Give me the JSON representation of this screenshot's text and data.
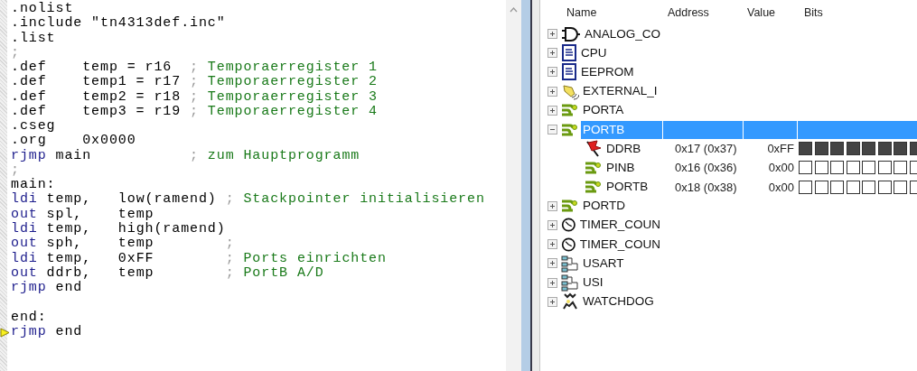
{
  "editor": {
    "lines": [
      {
        "current": false,
        "tokens": [
          {
            "kind": "plain",
            "text": ".nolist"
          }
        ]
      },
      {
        "current": false,
        "tokens": [
          {
            "kind": "plain",
            "text": ".include \"tn4313def.inc\""
          }
        ]
      },
      {
        "current": false,
        "tokens": [
          {
            "kind": "plain",
            "text": ".list"
          }
        ]
      },
      {
        "current": false,
        "tokens": [
          {
            "kind": "separator",
            "text": ";"
          }
        ]
      },
      {
        "current": false,
        "tokens": [
          {
            "kind": "plain",
            "text": ".def    temp = r16  "
          },
          {
            "kind": "separator",
            "text": "; "
          },
          {
            "kind": "comment",
            "text": "Temporaerregister 1"
          }
        ]
      },
      {
        "current": false,
        "tokens": [
          {
            "kind": "plain",
            "text": ".def    temp1 = r17 "
          },
          {
            "kind": "separator",
            "text": "; "
          },
          {
            "kind": "comment",
            "text": "Temporaerregister 2"
          }
        ]
      },
      {
        "current": false,
        "tokens": [
          {
            "kind": "plain",
            "text": ".def    temp2 = r18 "
          },
          {
            "kind": "separator",
            "text": "; "
          },
          {
            "kind": "comment",
            "text": "Temporaerregister 3"
          }
        ]
      },
      {
        "current": false,
        "tokens": [
          {
            "kind": "plain",
            "text": ".def    temp3 = r19 "
          },
          {
            "kind": "separator",
            "text": "; "
          },
          {
            "kind": "comment",
            "text": "Temporaerregister 4"
          }
        ]
      },
      {
        "current": false,
        "tokens": [
          {
            "kind": "plain",
            "text": ".cseg"
          }
        ]
      },
      {
        "current": false,
        "tokens": [
          {
            "kind": "plain",
            "text": ".org    0x0000"
          }
        ]
      },
      {
        "current": false,
        "tokens": [
          {
            "kind": "keyword",
            "text": "rjmp"
          },
          {
            "kind": "plain",
            "text": " main           "
          },
          {
            "kind": "separator",
            "text": "; "
          },
          {
            "kind": "comment",
            "text": "zum Hauptprogramm"
          }
        ]
      },
      {
        "current": false,
        "tokens": [
          {
            "kind": "separator",
            "text": ";"
          }
        ]
      },
      {
        "current": false,
        "tokens": [
          {
            "kind": "plain",
            "text": "main:"
          }
        ]
      },
      {
        "current": false,
        "tokens": [
          {
            "kind": "keyword",
            "text": "ldi"
          },
          {
            "kind": "plain",
            "text": " temp,   low(ramend) "
          },
          {
            "kind": "separator",
            "text": "; "
          },
          {
            "kind": "comment",
            "text": "Stackpointer initialisieren"
          }
        ]
      },
      {
        "current": false,
        "tokens": [
          {
            "kind": "keyword",
            "text": "out"
          },
          {
            "kind": "plain",
            "text": " spl,    temp"
          }
        ]
      },
      {
        "current": false,
        "tokens": [
          {
            "kind": "keyword",
            "text": "ldi"
          },
          {
            "kind": "plain",
            "text": " temp,   high(ramend)"
          }
        ]
      },
      {
        "current": false,
        "tokens": [
          {
            "kind": "keyword",
            "text": "out"
          },
          {
            "kind": "plain",
            "text": " sph,    temp        "
          },
          {
            "kind": "separator",
            "text": ";"
          }
        ]
      },
      {
        "current": false,
        "tokens": [
          {
            "kind": "keyword",
            "text": "ldi"
          },
          {
            "kind": "plain",
            "text": " temp,   0xFF        "
          },
          {
            "kind": "separator",
            "text": "; "
          },
          {
            "kind": "comment",
            "text": "Ports einrichten"
          }
        ]
      },
      {
        "current": false,
        "tokens": [
          {
            "kind": "keyword",
            "text": "out"
          },
          {
            "kind": "plain",
            "text": " ddrb,   temp        "
          },
          {
            "kind": "separator",
            "text": "; "
          },
          {
            "kind": "comment",
            "text": "PortB A/D"
          }
        ]
      },
      {
        "current": false,
        "tokens": [
          {
            "kind": "keyword",
            "text": "rjmp"
          },
          {
            "kind": "plain",
            "text": " end"
          }
        ]
      },
      {
        "current": false
      },
      {
        "current": false,
        "tokens": [
          {
            "kind": "plain",
            "text": "end:"
          }
        ]
      },
      {
        "current": true,
        "tokens": [
          {
            "kind": "keyword",
            "text": "rjmp"
          },
          {
            "kind": "plain",
            "text": " end"
          }
        ]
      }
    ]
  },
  "registers": {
    "columns": [
      "Name",
      "Address",
      "Value",
      "Bits"
    ],
    "items": [
      {
        "name": "ANALOG_CO",
        "kind": "gate",
        "expanded": false,
        "selected": false
      },
      {
        "name": "CPU",
        "kind": "document",
        "expanded": false,
        "selected": false
      },
      {
        "name": "EEPROM",
        "kind": "document",
        "expanded": false,
        "selected": false
      },
      {
        "name": "EXTERNAL_I",
        "kind": "bell",
        "expanded": false,
        "selected": false
      },
      {
        "name": "PORTA",
        "kind": "port",
        "expanded": false,
        "selected": false
      },
      {
        "name": "PORTB",
        "kind": "port",
        "expanded": true,
        "selected": true,
        "children": [
          {
            "name": "DDRB",
            "kind": "flag",
            "address": "0x17 (0x37)",
            "value": "0xFF",
            "bits": [
              true,
              true,
              true,
              true,
              true,
              true,
              true,
              true
            ]
          },
          {
            "name": "PINB",
            "kind": "port",
            "address": "0x16 (0x36)",
            "value": "0x00",
            "bits": [
              false,
              false,
              false,
              false,
              false,
              false,
              false,
              false
            ]
          },
          {
            "name": "PORTB",
            "kind": "port",
            "address": "0x18 (0x38)",
            "value": "0x00",
            "bits": [
              false,
              false,
              false,
              false,
              false,
              false,
              false,
              false
            ]
          }
        ]
      },
      {
        "name": "PORTD",
        "kind": "port",
        "expanded": false,
        "selected": false
      },
      {
        "name": "TIMER_COUN",
        "kind": "clock",
        "expanded": false,
        "selected": false
      },
      {
        "name": "TIMER_COUN",
        "kind": "clock",
        "expanded": false,
        "selected": false
      },
      {
        "name": "USART",
        "kind": "serial",
        "expanded": false,
        "selected": false
      },
      {
        "name": "USI",
        "kind": "serial",
        "expanded": false,
        "selected": false
      },
      {
        "name": "WATCHDOG",
        "kind": "dog",
        "expanded": false,
        "selected": false
      }
    ]
  }
}
